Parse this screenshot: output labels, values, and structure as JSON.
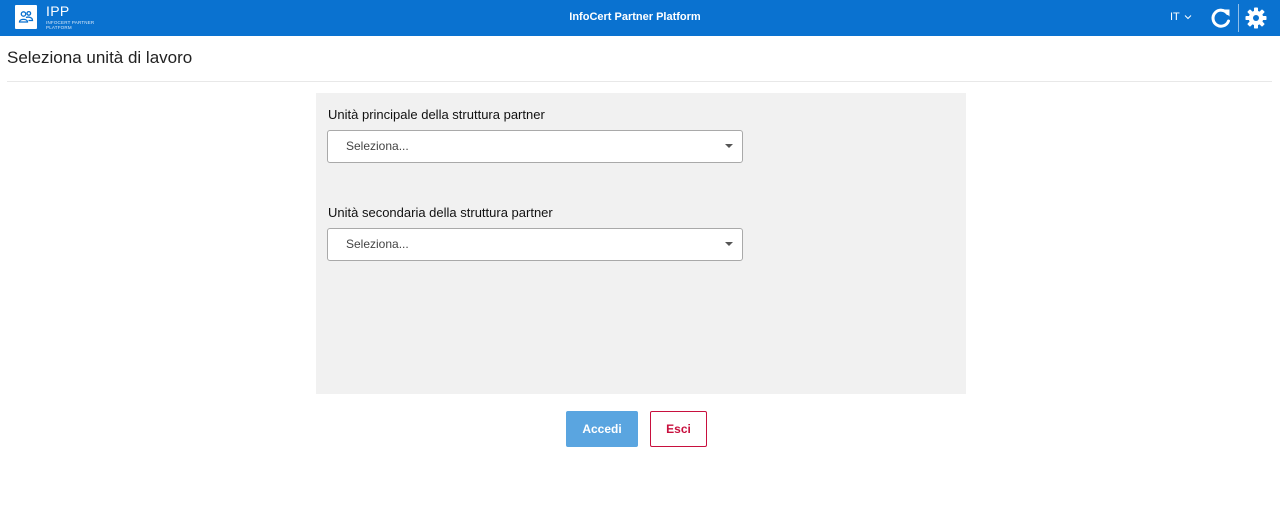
{
  "header": {
    "logo_title": "IPP",
    "logo_subtitle": "INFOCERT PARTNER PLATFORM",
    "app_title": "InfoCert Partner Platform",
    "language": "IT",
    "icons": [
      "users-icon",
      "chevron-down-icon",
      "refresh-icon",
      "gear-icon"
    ],
    "color": "#0a72d0"
  },
  "page": {
    "title": "Seleziona unità di lavoro"
  },
  "form": {
    "primary": {
      "label": "Unità principale della struttura partner",
      "placeholder": "Seleziona..."
    },
    "secondary": {
      "label": "Unità secondaria della struttura partner",
      "placeholder": "Seleziona..."
    }
  },
  "actions": {
    "accedi_label": "Accedi",
    "esci_label": "Esci",
    "accedi_color": "#5aa5e0",
    "esci_color": "#c8103e"
  }
}
